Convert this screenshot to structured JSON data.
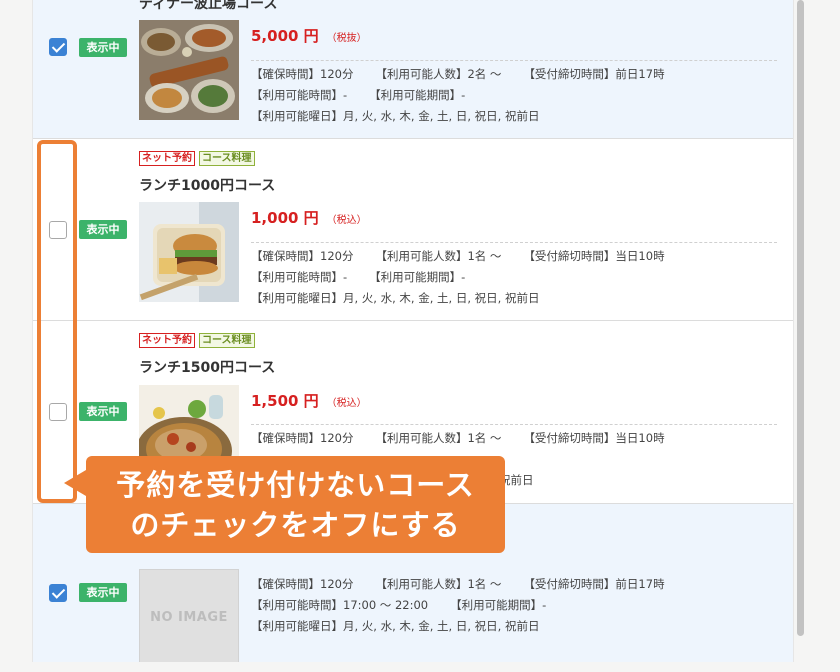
{
  "courses": [
    {
      "checked": true,
      "status": "表示中",
      "title": "ディナー波止場コース",
      "price": "5,000 円",
      "tax": "（税抜）",
      "info": {
        "hold_time": "【確保時間】120分",
        "people": "【利用可能人数】2名 〜",
        "deadline": "【受付締切時間】前日17時",
        "avail_time": "【利用可能時間】-",
        "avail_period": "【利用可能期間】-",
        "days": "【利用可能曜日】月, 火, 水, 木, 金, 土, 日, 祝日, 祝前日"
      }
    },
    {
      "checked": false,
      "status": "表示中",
      "tags": [
        "ネット予約",
        "コース料理"
      ],
      "title": "ランチ1000円コース",
      "price": "1,000 円",
      "tax": "（税込）",
      "info": {
        "hold_time": "【確保時間】120分",
        "people": "【利用可能人数】1名 〜",
        "deadline": "【受付締切時間】当日10時",
        "avail_time": "【利用可能時間】-",
        "avail_period": "【利用可能期間】-",
        "days": "【利用可能曜日】月, 火, 水, 木, 金, 土, 日, 祝日, 祝前日"
      }
    },
    {
      "checked": false,
      "status": "表示中",
      "tags": [
        "ネット予約",
        "コース料理"
      ],
      "title": "ランチ1500円コース",
      "price": "1,500 円",
      "tax": "（税込）",
      "info": {
        "hold_time": "【確保時間】120分",
        "people": "【利用可能人数】1名 〜",
        "deadline": "【受付締切時間】当日10時",
        "days_tail": "祝前日"
      }
    },
    {
      "checked": true,
      "status": "表示中",
      "thumb_text": "NO IMAGE",
      "info": {
        "hold_time": "【確保時間】120分",
        "people": "【利用可能人数】1名 〜",
        "deadline": "【受付締切時間】前日17時",
        "avail_time": "【利用可能時間】17:00 〜 22:00",
        "avail_period": "【利用可能期間】-",
        "days": "【利用可能曜日】月, 火, 水, 木, 金, 土, 日, 祝日, 祝前日"
      }
    }
  ],
  "callout": {
    "line1": "予約を受け付けないコース",
    "line2": "のチェックをオフにする"
  },
  "colors": {
    "accent": "#ec7f35",
    "checkbox_on": "#3b82d4",
    "status_badge": "#3cb36a",
    "price": "#d62020"
  }
}
